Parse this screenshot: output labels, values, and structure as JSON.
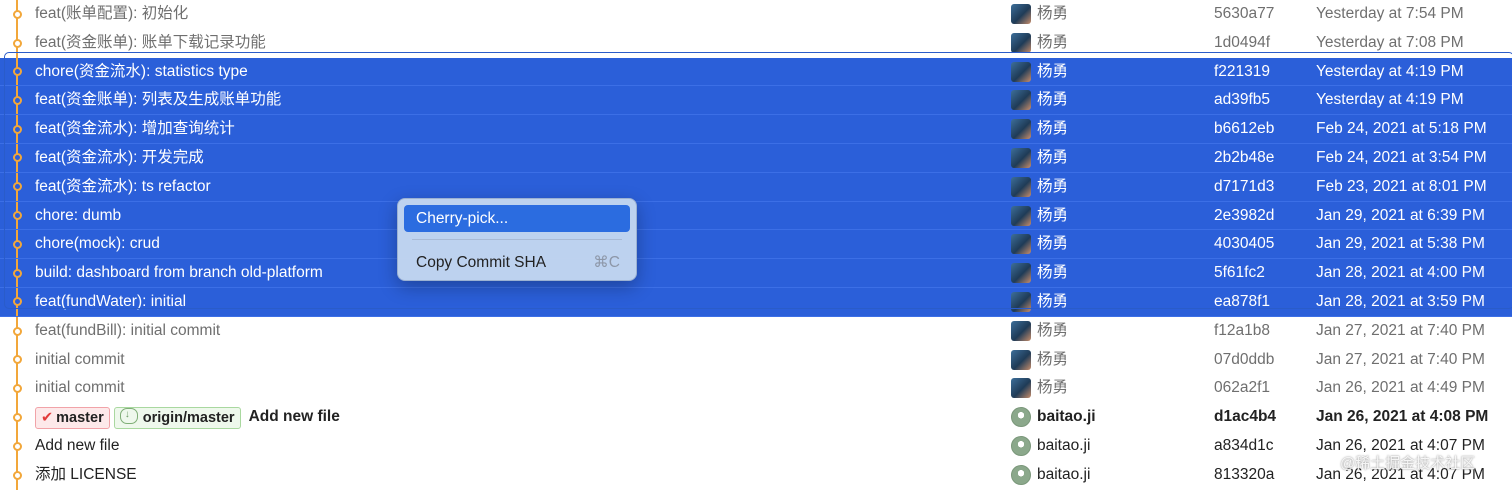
{
  "commits": [
    {
      "message": "feat(账单配置): 初始化",
      "author": "杨勇",
      "sha": "5630a77",
      "date": "Yesterday at 7:54 PM",
      "state": "dim"
    },
    {
      "message": "feat(资金账单): 账单下载记录功能",
      "author": "杨勇",
      "sha": "1d0494f",
      "date": "Yesterday at 7:08 PM",
      "state": "dim"
    },
    {
      "message": "chore(资金流水): statistics type",
      "author": "杨勇",
      "sha": "f221319",
      "date": "Yesterday at 4:19 PM",
      "state": "selected"
    },
    {
      "message": "feat(资金账单): 列表及生成账单功能",
      "author": "杨勇",
      "sha": "ad39fb5",
      "date": "Yesterday at 4:19 PM",
      "state": "selected"
    },
    {
      "message": "feat(资金流水): 增加查询统计",
      "author": "杨勇",
      "sha": "b6612eb",
      "date": "Feb 24, 2021 at 5:18 PM",
      "state": "selected"
    },
    {
      "message": "feat(资金流水): 开发完成",
      "author": "杨勇",
      "sha": "2b2b48e",
      "date": "Feb 24, 2021 at 3:54 PM",
      "state": "selected"
    },
    {
      "message": "feat(资金流水): ts refactor",
      "author": "杨勇",
      "sha": "d7171d3",
      "date": "Feb 23, 2021 at 8:01 PM",
      "state": "selected"
    },
    {
      "message": "chore: dumb",
      "author": "杨勇",
      "sha": "2e3982d",
      "date": "Jan 29, 2021 at 6:39 PM",
      "state": "selected"
    },
    {
      "message": "chore(mock): crud",
      "author": "杨勇",
      "sha": "4030405",
      "date": "Jan 29, 2021 at 5:38 PM",
      "state": "selected"
    },
    {
      "message": "build: dashboard from branch old-platform",
      "author": "杨勇",
      "sha": "5f61fc2",
      "date": "Jan 28, 2021 at 4:00 PM",
      "state": "selected"
    },
    {
      "message": "feat(fundWater): initial",
      "author": "杨勇",
      "sha": "ea878f1",
      "date": "Jan 28, 2021 at 3:59 PM",
      "state": "selected"
    },
    {
      "message": "feat(fundBill): initial commit",
      "author": "杨勇",
      "sha": "f12a1b8",
      "date": "Jan 27, 2021 at 7:40 PM",
      "state": "dim"
    },
    {
      "message": "initial commit",
      "author": "杨勇",
      "sha": "07d0ddb",
      "date": "Jan 27, 2021 at 7:40 PM",
      "state": "dim"
    },
    {
      "message": "initial commit",
      "author": "杨勇",
      "sha": "062a2f1",
      "date": "Jan 26, 2021 at 4:49 PM",
      "state": "dim"
    },
    {
      "message": "Add new file",
      "author": "baitao.ji",
      "sha": "d1ac4b4",
      "date": "Jan 26, 2021 at 4:08 PM",
      "state": "head",
      "branches": [
        {
          "name": "master",
          "icon": "check-icon"
        },
        {
          "name": "origin/master",
          "icon": "cloud-icon"
        }
      ]
    },
    {
      "message": "Add new file",
      "author": "baitao.ji",
      "sha": "a834d1c",
      "date": "Jan 26, 2021 at 4:07 PM",
      "state": "normal"
    },
    {
      "message": "添加 LICENSE",
      "author": "baitao.ji",
      "sha": "813320a",
      "date": "Jan 26, 2021 at 4:07 PM",
      "state": "normal"
    }
  ],
  "context_menu": {
    "items": [
      {
        "label": "Cherry-pick...",
        "shortcut": ""
      },
      {
        "label": "Copy Commit SHA",
        "shortcut": "⌘C"
      }
    ]
  },
  "watermark": "@稀土掘金技术社区",
  "colors": {
    "selection": "#2b5fd9",
    "graph": "#f2a73a",
    "menu_highlight": "#2b6ce0"
  }
}
